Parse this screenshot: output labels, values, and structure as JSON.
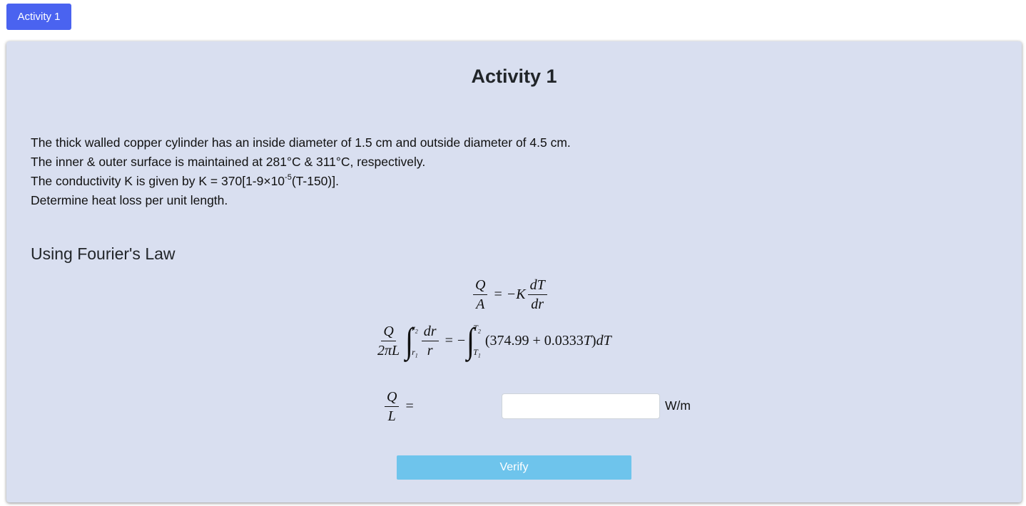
{
  "tabs": [
    {
      "label": "Activity 1"
    }
  ],
  "panel": {
    "title": "Activity 1",
    "problem": {
      "line1": "The thick walled copper cylinder has an inside diameter of 1.5 cm and outside diameter of 4.5 cm.",
      "line2": "The inner & outer surface is maintained at 281°C & 311°C, respectively.",
      "line3_prefix": "The conductivity K is given by K = 370[1-9×10",
      "line3_exponent": "-5",
      "line3_suffix": "(T-150)].",
      "line4": "Determine heat loss per unit length."
    },
    "section_title": "Using Fourier's Law",
    "equations": {
      "eq1": {
        "lhs_num": "Q",
        "lhs_den": "A",
        "equals": "=",
        "rhs_prefix": "−K",
        "rhs_num": "dT",
        "rhs_den": "dr"
      },
      "eq2": {
        "lhs_num": "Q",
        "lhs_den": "2πL",
        "int1_upper": "r",
        "int1_upper_sub": "2",
        "int1_lower": "r",
        "int1_lower_sub": "1",
        "int1_num": "dr",
        "int1_den": "r",
        "equals": "=",
        "minus": "−",
        "int2_upper": "T",
        "int2_upper_sub": "2",
        "int2_lower": "T",
        "int2_lower_sub": "1",
        "integrand": "(374.99 + 0.0333",
        "integrand_var": "T",
        "integrand_close": ")",
        "differential": "dT"
      },
      "eq3": {
        "lhs_num": "Q",
        "lhs_den": "L",
        "equals": "="
      }
    },
    "answer": {
      "value": "",
      "placeholder": "",
      "unit": "W/m"
    },
    "verify_label": "Verify"
  },
  "colors": {
    "tab_button": "#4a63f0",
    "panel_background": "#d9dff0",
    "verify_button": "#6ec4ec"
  }
}
